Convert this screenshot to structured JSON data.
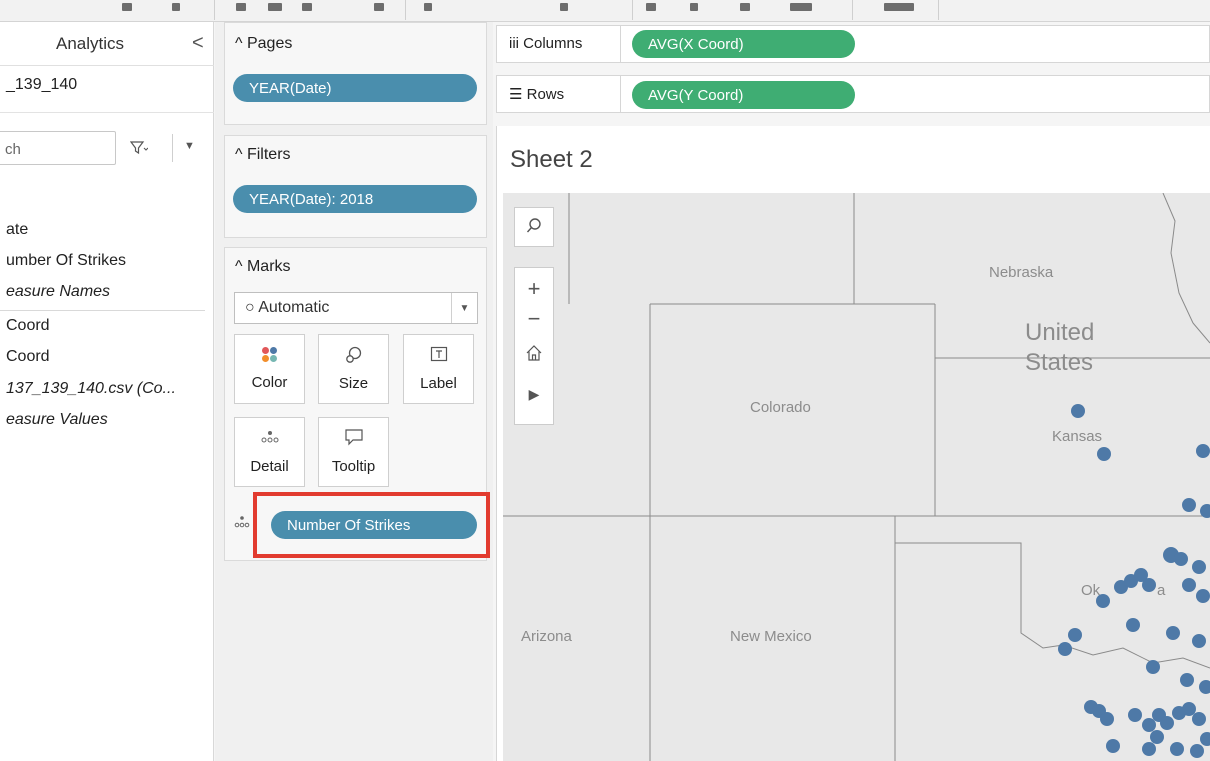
{
  "data_pane": {
    "tab_label": "Analytics",
    "collapse_label": "<",
    "source_name": "_139_140",
    "search_placeholder": "ch",
    "fields": [
      {
        "label": "ate",
        "italic": false
      },
      {
        "label": "umber Of Strikes",
        "italic": false
      },
      {
        "label": "easure Names",
        "italic": true
      },
      {
        "label": "Coord",
        "italic": false
      },
      {
        "label": "Coord",
        "italic": false
      },
      {
        "label": "137_139_140.csv (Co...",
        "italic": true
      },
      {
        "label": "easure Values",
        "italic": true
      }
    ]
  },
  "pages": {
    "title": "Pages",
    "pill": "YEAR(Date)"
  },
  "filters": {
    "title": "Filters",
    "pill": "YEAR(Date): 2018"
  },
  "marks": {
    "title": "Marks",
    "mark_type": "Automatic",
    "buttons": {
      "color": "Color",
      "size": "Size",
      "label": "Label",
      "detail": "Detail",
      "tooltip": "Tooltip"
    },
    "detail_pill": "Number Of Strikes"
  },
  "shelves": {
    "columns_label": "Columns",
    "columns_pill": "AVG(X Coord)",
    "rows_label": "Rows",
    "rows_pill": "AVG(Y Coord)"
  },
  "sheet": {
    "title": "Sheet 2"
  },
  "map": {
    "labels": {
      "nebraska": "Nebraska",
      "united": "United",
      "states": "States",
      "colorado": "Colorado",
      "kansas": "Kansas",
      "oklahoma_partial": "Ok",
      "oklahoma_tail": "a",
      "arizona": "Arizona",
      "new_mexico": "New Mexico"
    },
    "colors": {
      "mark": "#4e79a7",
      "land": "#e8e8e8",
      "border": "#8a8a8a",
      "text": "#8c8c8c"
    }
  },
  "colors": {
    "pill_blue": "#4a8ead",
    "pill_green": "#3fad73",
    "highlight": "#e23b2f"
  }
}
